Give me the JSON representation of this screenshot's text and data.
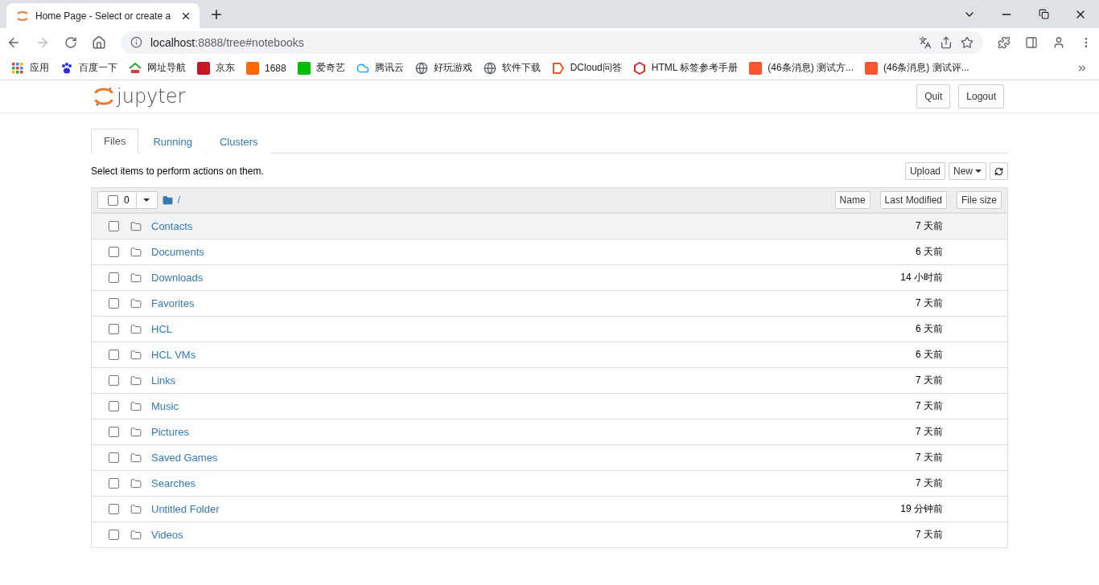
{
  "browser": {
    "tab_title": "Home Page - Select or create a",
    "url_host": "localhost",
    "url_rest": ":8888/tree#notebooks",
    "bookmarks": [
      {
        "label": "应用",
        "kind": "apps"
      },
      {
        "label": "百度一下",
        "kind": "paw"
      },
      {
        "label": "网址导航",
        "kind": "house"
      },
      {
        "label": "京东",
        "kind": "jd"
      },
      {
        "label": "1688",
        "kind": "orange"
      },
      {
        "label": "爱奇艺",
        "kind": "green"
      },
      {
        "label": "腾讯云",
        "kind": "cloud"
      },
      {
        "label": "好玩游戏",
        "kind": "globe"
      },
      {
        "label": "软件下载",
        "kind": "globe"
      },
      {
        "label": "DCloud问答",
        "kind": "dcloud"
      },
      {
        "label": "HTML 标签参考手册",
        "kind": "shield"
      },
      {
        "label": "(46条消息) 测试方...",
        "kind": "csdn"
      },
      {
        "label": "(46条消息) 测试评...",
        "kind": "csdn"
      }
    ]
  },
  "header": {
    "logo_text": "jupyter",
    "buttons": [
      "Quit",
      "Logout"
    ]
  },
  "tabs": [
    {
      "label": "Files",
      "selected": true
    },
    {
      "label": "Running",
      "selected": false
    },
    {
      "label": "Clusters",
      "selected": false
    }
  ],
  "toolbar": {
    "hint": "Select items to perform actions on them.",
    "upload": "Upload",
    "new": "New"
  },
  "list_header": {
    "select_all_checked": false,
    "count": "0",
    "path": "/",
    "sort_buttons": [
      "Name",
      "Last Modified",
      "File size"
    ]
  },
  "rows": [
    {
      "name": "Contacts",
      "modified": "7 天前",
      "checked": false,
      "highlighted": true
    },
    {
      "name": "Documents",
      "modified": "6 天前",
      "checked": false,
      "highlighted": false
    },
    {
      "name": "Downloads",
      "modified": "14 小时前",
      "checked": false,
      "highlighted": false
    },
    {
      "name": "Favorites",
      "modified": "7 天前",
      "checked": false,
      "highlighted": false
    },
    {
      "name": "HCL",
      "modified": "6 天前",
      "checked": false,
      "highlighted": false
    },
    {
      "name": "HCL VMs",
      "modified": "6 天前",
      "checked": false,
      "highlighted": false
    },
    {
      "name": "Links",
      "modified": "7 天前",
      "checked": false,
      "highlighted": false
    },
    {
      "name": "Music",
      "modified": "7 天前",
      "checked": false,
      "highlighted": false
    },
    {
      "name": "Pictures",
      "modified": "7 天前",
      "checked": false,
      "highlighted": false
    },
    {
      "name": "Saved Games",
      "modified": "7 天前",
      "checked": false,
      "highlighted": false
    },
    {
      "name": "Searches",
      "modified": "7 天前",
      "checked": false,
      "highlighted": false
    },
    {
      "name": "Untitled Folder",
      "modified": "19 分钟前",
      "checked": false,
      "highlighted": false
    },
    {
      "name": "Videos",
      "modified": "7 天前",
      "checked": false,
      "highlighted": false
    }
  ]
}
